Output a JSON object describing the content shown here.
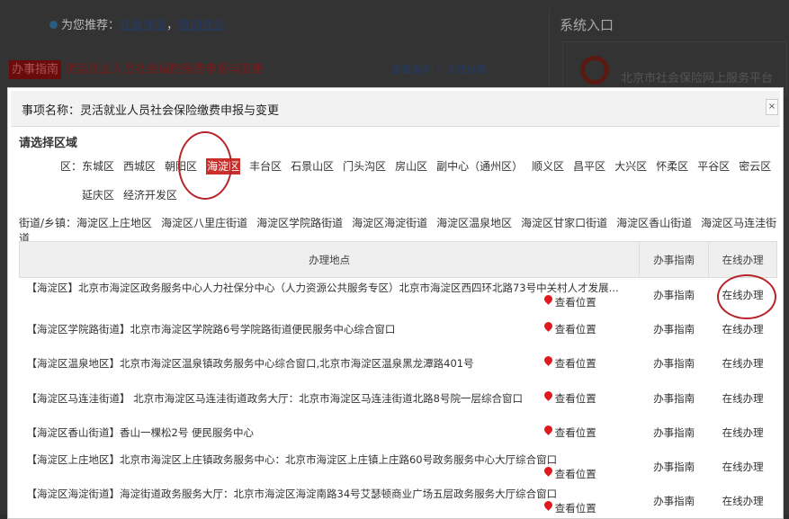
{
  "background": {
    "recommend_label": "为您推荐：",
    "recommend_links": [
      "社会保险",
      "培训就业"
    ],
    "guide_tag": "办事指南",
    "guide_title": "灵活就业人员社会保险缴费申报与变更",
    "view_guide": "查看指南",
    "online": "在线办理",
    "sys_title": "系统入口",
    "platform": "北京市社会保险网上服务平台"
  },
  "dialog": {
    "title": "事项名称：灵活就业人员社会保险缴费申报与变更",
    "close": "×",
    "select_title": "请选择区域",
    "district_label": "区：",
    "districts": [
      "东城区",
      "西城区",
      "朝阳区",
      "海淀区",
      "丰台区",
      "石景山区",
      "门头沟区",
      "房山区",
      "副中心（通州区）",
      "顺义区",
      "昌平区",
      "大兴区",
      "怀柔区",
      "平谷区",
      "密云区",
      "延庆区",
      "经济开发区"
    ],
    "selected_district": "海淀区",
    "street_label": "街道/乡镇：",
    "streets": [
      "海淀区上庄地区",
      "海淀区八里庄街道",
      "海淀区学院路街道",
      "海淀区海淀街道",
      "海淀区温泉地区",
      "海淀区甘家口街道",
      "海淀区香山街道",
      "海淀区马连洼街道"
    ],
    "table": {
      "headers": [
        "办理地点",
        "办事指南",
        "在线办理"
      ],
      "rows": [
        {
          "place": "【海淀区】北京市海淀区政务服务中心人力社保分中心（人力资源公共服务专区）北京市海淀区西四环北路73号中关村人才发展...",
          "loc": "查看位置",
          "guide": "办事指南",
          "online": "在线办理"
        },
        {
          "place": "【海淀区学院路街道】北京市海淀区学院路6号学院路街道便民服务中心综合窗口",
          "loc": "查看位置",
          "guide": "办事指南",
          "online": "在线办理"
        },
        {
          "place": "【海淀区温泉地区】北京市海淀区温泉镇政务服务中心综合窗口,北京市海淀区温泉黑龙潭路401号",
          "loc": "查看位置",
          "guide": "办事指南",
          "online": "在线办理"
        },
        {
          "place": "【海淀区马连洼街道】 北京市海淀区马连洼街道政务大厅：北京市海淀区马连洼街道北路8号院一层综合窗口",
          "loc": "查看位置",
          "guide": "办事指南",
          "online": "在线办理"
        },
        {
          "place": "【海淀区香山街道】香山一棵松2号 便民服务中心",
          "loc": "查看位置",
          "guide": "办事指南",
          "online": "在线办理"
        },
        {
          "place": "【海淀区上庄地区】北京市海淀区上庄镇政务服务中心：北京市海淀区上庄镇上庄路60号政务服务中心大厅综合窗口",
          "loc": "查看位置",
          "guide": "办事指南",
          "online": "在线办理"
        },
        {
          "place": "【海淀区海淀街道】海淀街道政务服务大厅：北京市海淀区海淀南路34号艾瑟顿商业广场五层政务服务大厅综合窗口",
          "loc": "查看位置",
          "guide": "办事指南",
          "online": "在线办理"
        }
      ]
    }
  }
}
